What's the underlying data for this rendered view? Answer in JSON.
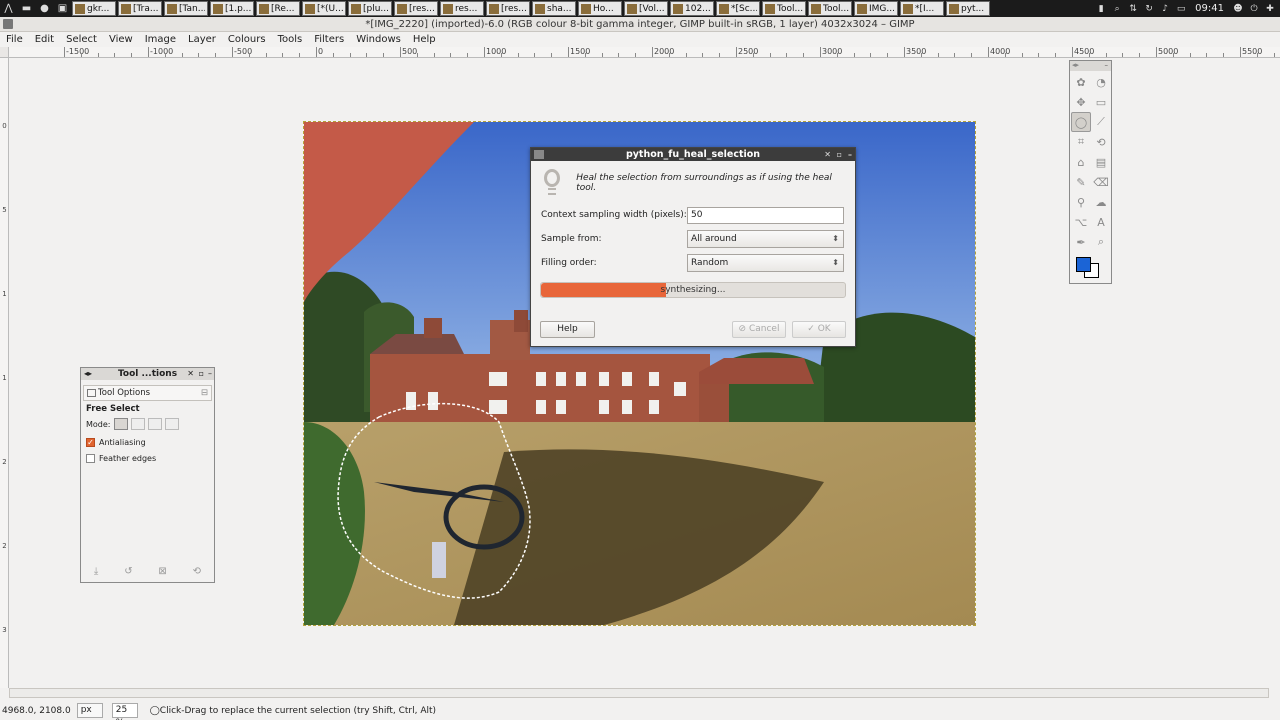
{
  "taskbar": {
    "tasks": [
      "gkr...",
      "[Tra...",
      "[Tan...",
      "[1.p...",
      "[Re...",
      "[*(U...",
      "[plu...",
      "[res...",
      "res...",
      "[res...",
      "sha...",
      "Ho...",
      "[Vol...",
      "102...",
      "*[Sc...",
      "Tool...",
      "Tool...",
      "IMG...",
      "*[I...",
      "pyt..."
    ],
    "clock": "09:41"
  },
  "window": {
    "title": "*[IMG_2220] (imported)-6.0 (RGB colour 8-bit gamma integer, GIMP built-in sRGB, 1 layer) 4032x3024 – GIMP"
  },
  "menu": [
    "File",
    "Edit",
    "Select",
    "View",
    "Image",
    "Layer",
    "Colours",
    "Tools",
    "Filters",
    "Windows",
    "Help"
  ],
  "ruler": {
    "h_labels": [
      "-1500",
      "-1000",
      "-500",
      "0",
      "500",
      "1000",
      "1500",
      "2000",
      "2500",
      "3000",
      "3500",
      "4000",
      "4500",
      "5000",
      "5500"
    ],
    "v_labels": [
      "0",
      "5",
      "1",
      "1",
      "2",
      "2",
      "3"
    ]
  },
  "tool_options": {
    "dock_title": "Tool ...tions",
    "tab_label": "Tool Options",
    "tool_name": "Free Select",
    "mode_label": "Mode:",
    "antialiasing_label": "Antialiasing",
    "antialiasing_checked": true,
    "feather_label": "Feather edges",
    "feather_checked": false
  },
  "dialog": {
    "title": "python_fu_heal_selection",
    "description": "Heal the selection from surroundings as if using the heal tool.",
    "context_label": "Context sampling width (pixels):",
    "context_value": "50",
    "sample_label": "Sample from:",
    "sample_value": "All around",
    "filling_label": "Filling order:",
    "filling_value": "Random",
    "progress_text": "synthesizing...",
    "progress_fraction": 0.41,
    "help_label": "Help",
    "cancel_label": "Cancel",
    "ok_label": "OK"
  },
  "toolbox": {
    "fg_color": "#1b64d6",
    "bg_color": "#ffffff"
  },
  "status": {
    "coords": "4968.0, 2108.0",
    "unit": "px",
    "zoom": "25 %",
    "message": "Click-Drag to replace the current selection (try Shift, Ctrl, Alt)"
  }
}
